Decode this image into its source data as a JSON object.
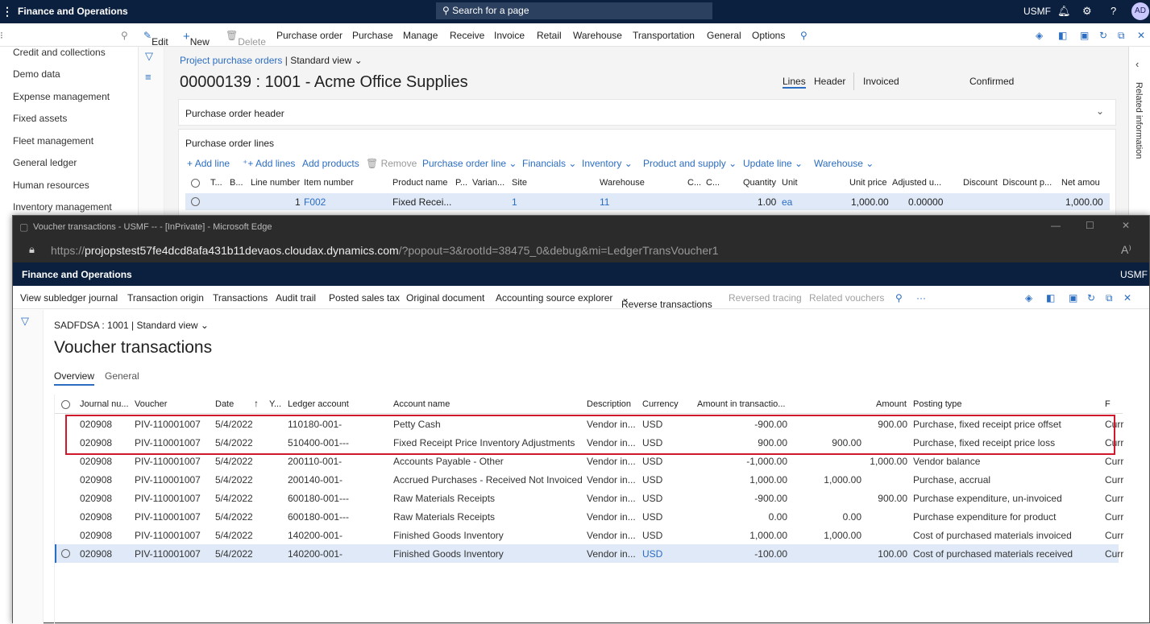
{
  "topbar": {
    "app_title": "Finance and Operations",
    "search_placeholder": "Search for a page",
    "company": "USMF",
    "avatar": "AD"
  },
  "actionbar": {
    "items": [
      "Edit",
      "New",
      "Delete",
      "Purchase order",
      "Purchase",
      "Manage",
      "Receive",
      "Invoice",
      "Retail",
      "Warehouse",
      "Transportation",
      "General",
      "Options"
    ],
    "badge": "0"
  },
  "nav": {
    "items": [
      "Credit and collections",
      "Demo data",
      "Expense management",
      "Fixed assets",
      "Fleet management",
      "General ledger",
      "Human resources",
      "Inventory management"
    ]
  },
  "po": {
    "breadcrumb": "Project purchase orders",
    "view": "Standard view",
    "title": "00000139 : 1001 - Acme Office Supplies",
    "tabs": [
      "Lines",
      "Header"
    ],
    "status1": "Invoiced",
    "status2": "Confirmed",
    "header_section": "Purchase order header",
    "lines_section": "Purchase order lines",
    "line_actions": [
      "Add line",
      "Add lines",
      "Add products",
      "Remove",
      "Purchase order line",
      "Financials",
      "Inventory",
      "Product and supply",
      "Update line",
      "Warehouse"
    ],
    "columns": [
      "T...",
      "B...",
      "Line number",
      "Item number",
      "Product name",
      "P...",
      "Varian...",
      "Site",
      "Warehouse",
      "C...",
      "C...",
      "Quantity",
      "Unit",
      "Unit price",
      "Adjusted u...",
      "Discount",
      "Discount p...",
      "Net amou"
    ],
    "row": {
      "line": "1",
      "item": "F002",
      "product": "Fixed Recei...",
      "site": "1",
      "warehouse": "11",
      "qty": "1.00",
      "unit": "ea",
      "price": "1,000.00",
      "adjusted": "0.00000",
      "net": "1,000.00"
    }
  },
  "right_panel": {
    "label": "Related information"
  },
  "popup": {
    "window_title": "Voucher transactions - USMF -- - [InPrivate] - Microsoft Edge",
    "url_prefix": "https://",
    "url_host": "projopstest57fe4dcd8afa431b11devaos.cloudax.dynamics.com",
    "url_rest": "/?popout=3&rootId=38475_0&debug&mi=LedgerTransVoucher1",
    "app_title": "Finance and Operations",
    "company": "USMF",
    "actions": [
      "View subledger journal",
      "Transaction origin",
      "Transactions",
      "Audit trail",
      "Posted sales tax",
      "Original document",
      "Accounting source explorer",
      "Reverse transactions",
      "Reversed tracing",
      "Related vouchers"
    ],
    "badge": "0",
    "breadcrumb": "SADFDSA : 1001",
    "view": "Standard view",
    "title": "Voucher transactions",
    "tabs": [
      "Overview",
      "General"
    ],
    "columns": [
      "Journal nu...",
      "Voucher",
      "Date",
      "Y...",
      "Ledger account",
      "Account name",
      "Description",
      "Currency",
      "Amount in transactio...",
      "Amount",
      "Posting type",
      "F"
    ],
    "rows": [
      [
        "020908",
        "PIV-110001007",
        "5/4/2022",
        "110180-001-",
        "Petty Cash",
        "Vendor in...",
        "USD",
        "-900.00",
        "",
        "900.00",
        "Purchase, fixed receipt price offset",
        "Curr"
      ],
      [
        "020908",
        "PIV-110001007",
        "5/4/2022",
        "510400-001---",
        "Fixed Receipt Price Inventory Adjustments",
        "Vendor in...",
        "USD",
        "900.00",
        "900.00",
        "",
        "Purchase, fixed receipt price loss",
        "Curr"
      ],
      [
        "020908",
        "PIV-110001007",
        "5/4/2022",
        "200110-001-",
        "Accounts Payable - Other",
        "Vendor in...",
        "USD",
        "-1,000.00",
        "",
        "1,000.00",
        "Vendor balance",
        "Curr"
      ],
      [
        "020908",
        "PIV-110001007",
        "5/4/2022",
        "200140-001-",
        "Accrued Purchases - Received Not Invoiced",
        "Vendor in...",
        "USD",
        "1,000.00",
        "1,000.00",
        "",
        "Purchase, accrual",
        "Curr"
      ],
      [
        "020908",
        "PIV-110001007",
        "5/4/2022",
        "600180-001---",
        "Raw Materials Receipts",
        "Vendor in...",
        "USD",
        "-900.00",
        "",
        "900.00",
        "Purchase expenditure, un-invoiced",
        "Curr"
      ],
      [
        "020908",
        "PIV-110001007",
        "5/4/2022",
        "600180-001---",
        "Raw Materials Receipts",
        "Vendor in...",
        "USD",
        "0.00",
        "0.00",
        "",
        "Purchase expenditure for product",
        "Curr"
      ],
      [
        "020908",
        "PIV-110001007",
        "5/4/2022",
        "140200-001-",
        "Finished Goods Inventory",
        "Vendor in...",
        "USD",
        "1,000.00",
        "1,000.00",
        "",
        "Cost of purchased materials invoiced",
        "Curr"
      ],
      [
        "020908",
        "PIV-110001007",
        "5/4/2022",
        "140200-001-",
        "Finished Goods Inventory",
        "Vendor in...",
        "USD",
        "-100.00",
        "",
        "100.00",
        "Cost of purchased materials received",
        "Curr"
      ]
    ]
  }
}
